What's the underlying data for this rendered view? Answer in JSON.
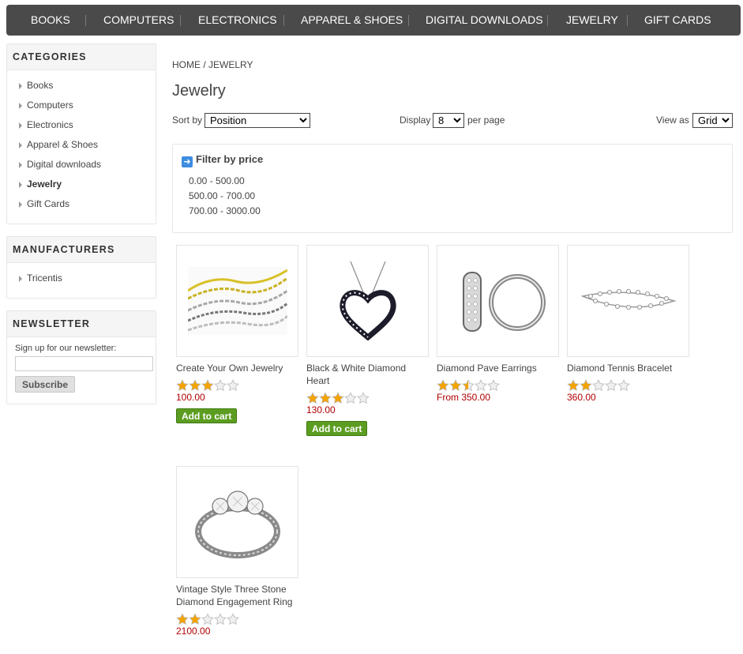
{
  "top_menu": [
    "BOOKS",
    "COMPUTERS",
    "ELECTRONICS",
    "APPAREL & SHOES",
    "DIGITAL DOWNLOADS",
    "JEWELRY",
    "GIFT CARDS"
  ],
  "categories": {
    "title": "CATEGORIES",
    "items": [
      "Books",
      "Computers",
      "Electronics",
      "Apparel & Shoes",
      "Digital downloads",
      "Jewelry",
      "Gift Cards"
    ],
    "active": "Jewelry"
  },
  "manufacturers": {
    "title": "MANUFACTURERS",
    "items": [
      "Tricentis"
    ]
  },
  "newsletter": {
    "title": "NEWSLETTER",
    "label": "Sign up for our newsletter:",
    "email_value": "",
    "button": "Subscribe"
  },
  "breadcrumb": {
    "home": "HOME",
    "separator": "/",
    "current": "JEWELRY"
  },
  "page_title": "Jewelry",
  "sort": {
    "label": "Sort by",
    "selected": "Position"
  },
  "display": {
    "label": "Display",
    "selected": "8",
    "suffix": "per page"
  },
  "view": {
    "label": "View as",
    "selected": "Grid"
  },
  "filter": {
    "title": "Filter by price",
    "ranges": [
      "0.00 - 500.00",
      "500.00 - 700.00",
      "700.00 - 3000.00"
    ]
  },
  "products": [
    {
      "title": "Create Your Own Jewelry",
      "rating": 3,
      "price": "100.00",
      "add_to_cart": "Add to cart",
      "image": "chains-image"
    },
    {
      "title": "Black & White Diamond Heart",
      "rating": 3,
      "price": "130.00",
      "add_to_cart": "Add to cart",
      "image": "heart-pendant-image"
    },
    {
      "title": "Diamond Pave Earrings",
      "rating": 2.5,
      "price": "From 350.00",
      "add_to_cart": "",
      "image": "hoop-earrings-image"
    },
    {
      "title": "Diamond Tennis Bracelet",
      "rating": 2,
      "price": "360.00",
      "add_to_cart": "",
      "image": "tennis-bracelet-image"
    },
    {
      "title": "Vintage Style Three Stone Diamond Engagement Ring",
      "rating": 2,
      "price": "2100.00",
      "add_to_cart": "",
      "image": "engagement-ring-image"
    }
  ],
  "colors": {
    "nav_bg": "#4a4a4a",
    "price": "#b10000",
    "add_to_cart_bg": "#5c9d21",
    "star_fill": "#f5a300"
  }
}
